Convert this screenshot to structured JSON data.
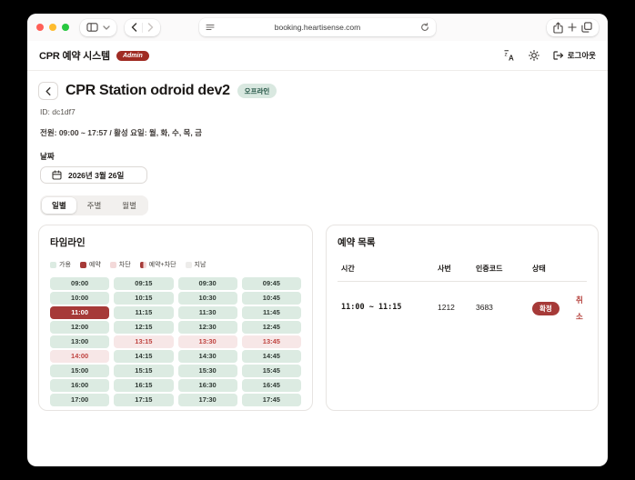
{
  "browser": {
    "url": "booking.heartisense.com"
  },
  "header": {
    "title": "CPR 예약 시스템",
    "admin_badge": "Admin",
    "logout_label": "로그아웃"
  },
  "station": {
    "title": "CPR Station odroid dev2",
    "status_badge": "오프라인",
    "id_line": "ID: dc1df7",
    "power_line": "전원: 09:00 ~ 17:57 / 활성 요일: 월, 화, 수, 목, 금"
  },
  "date": {
    "label": "날짜",
    "value": "2026년 3월 26일"
  },
  "tabs": [
    {
      "label": "일별",
      "active": true
    },
    {
      "label": "주별",
      "active": false
    },
    {
      "label": "월별",
      "active": false
    }
  ],
  "timeline": {
    "title": "타임라인",
    "legend": [
      {
        "label": "가용",
        "swatch": "#dcebe2"
      },
      {
        "label": "예약",
        "swatch": "#a63a38"
      },
      {
        "label": "차단",
        "swatch": "#f3d9d9"
      },
      {
        "label": "예약+차단",
        "swatch": "linear-gradient(90deg,#a63a38 0 50%,#f3d9d9 50% 100%)"
      },
      {
        "label": "지남",
        "swatch": "#edecea"
      }
    ],
    "slots": [
      {
        "time": "09:00",
        "state": "available"
      },
      {
        "time": "09:15",
        "state": "available"
      },
      {
        "time": "09:30",
        "state": "available"
      },
      {
        "time": "09:45",
        "state": "available"
      },
      {
        "time": "10:00",
        "state": "available"
      },
      {
        "time": "10:15",
        "state": "available"
      },
      {
        "time": "10:30",
        "state": "available"
      },
      {
        "time": "10:45",
        "state": "available"
      },
      {
        "time": "11:00",
        "state": "booked"
      },
      {
        "time": "11:15",
        "state": "available"
      },
      {
        "time": "11:30",
        "state": "available"
      },
      {
        "time": "11:45",
        "state": "available"
      },
      {
        "time": "12:00",
        "state": "available"
      },
      {
        "time": "12:15",
        "state": "available"
      },
      {
        "time": "12:30",
        "state": "available"
      },
      {
        "time": "12:45",
        "state": "available"
      },
      {
        "time": "13:00",
        "state": "available"
      },
      {
        "time": "13:15",
        "state": "blocked"
      },
      {
        "time": "13:30",
        "state": "blocked"
      },
      {
        "time": "13:45",
        "state": "blocked"
      },
      {
        "time": "14:00",
        "state": "blocked"
      },
      {
        "time": "14:15",
        "state": "available"
      },
      {
        "time": "14:30",
        "state": "available"
      },
      {
        "time": "14:45",
        "state": "available"
      },
      {
        "time": "15:00",
        "state": "available"
      },
      {
        "time": "15:15",
        "state": "available"
      },
      {
        "time": "15:30",
        "state": "available"
      },
      {
        "time": "15:45",
        "state": "available"
      },
      {
        "time": "16:00",
        "state": "available"
      },
      {
        "time": "16:15",
        "state": "available"
      },
      {
        "time": "16:30",
        "state": "available"
      },
      {
        "time": "16:45",
        "state": "available"
      },
      {
        "time": "17:00",
        "state": "available"
      },
      {
        "time": "17:15",
        "state": "available"
      },
      {
        "time": "17:30",
        "state": "available"
      },
      {
        "time": "17:45",
        "state": "available"
      }
    ]
  },
  "bookings": {
    "title": "예약 목록",
    "columns": [
      "시간",
      "사번",
      "인증코드",
      "상태"
    ],
    "rows": [
      {
        "time": "11:00 ~ 11:15",
        "employee_no": "1212",
        "auth_code": "3683",
        "status": "확정",
        "action": "취소"
      }
    ]
  },
  "colors": {
    "available_bg": "#dcebe2",
    "booked_bg": "#a63a38",
    "blocked_bg": "#f7e7e7",
    "blocked_text": "#bf4440",
    "admin_badge": "#a02c24",
    "offline_badge_bg": "#d9e8e0",
    "offline_badge_text": "#1d4f3f",
    "confirm_badge": "#a63a38",
    "cancel_link": "#b5413c"
  }
}
